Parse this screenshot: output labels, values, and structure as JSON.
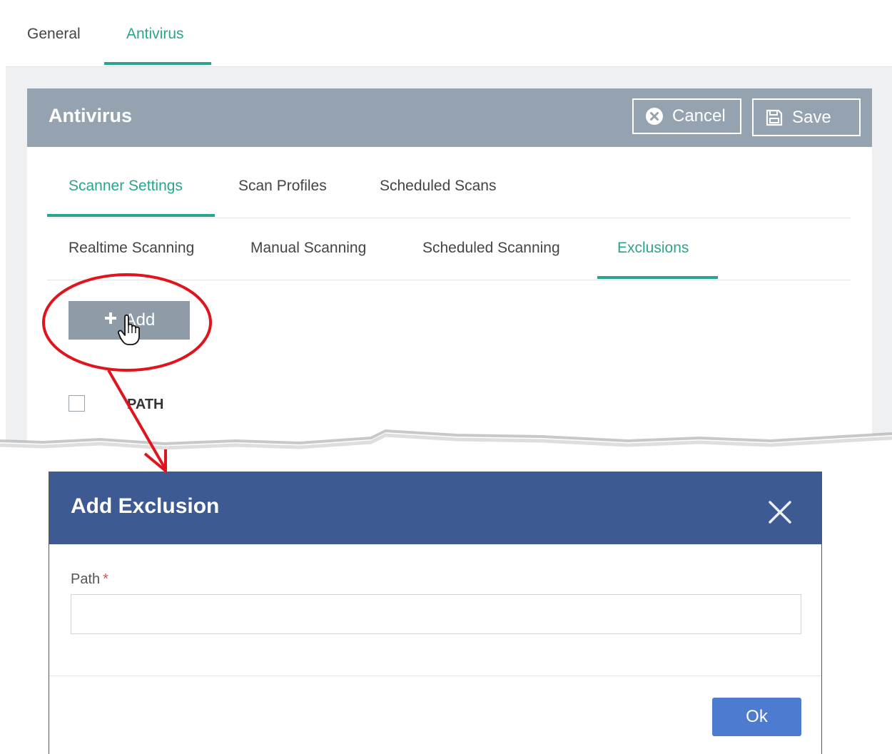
{
  "top_tabs": [
    {
      "label": "General"
    },
    {
      "label": "Antivirus"
    }
  ],
  "panel": {
    "title": "Antivirus",
    "cancel_label": "Cancel",
    "save_label": "Save"
  },
  "section_tabs": [
    {
      "label": "Scanner Settings"
    },
    {
      "label": "Scan Profiles"
    },
    {
      "label": "Scheduled Scans"
    }
  ],
  "scan_tabs": [
    {
      "label": "Realtime Scanning"
    },
    {
      "label": "Manual Scanning"
    },
    {
      "label": "Scheduled Scanning"
    },
    {
      "label": "Exclusions"
    }
  ],
  "active": {
    "top_tab": "Antivirus",
    "section_tab": "Scanner Settings",
    "scan_tab": "Exclusions"
  },
  "toolbar": {
    "add_label": "Add"
  },
  "table": {
    "columns": [
      "PATH"
    ]
  },
  "modal": {
    "title": "Add Exclusion",
    "path_label": "Path",
    "required_mark": "*",
    "path_value": "",
    "ok_label": "Ok"
  },
  "icons": {
    "cancel": "cancel-circle-icon",
    "save": "floppy-save-icon",
    "add": "plus-icon",
    "close": "close-icon",
    "cursor": "hand-pointer-icon"
  },
  "colors": {
    "accent": "#2aa58d",
    "panel_header": "#95a3b0",
    "modal_header": "#3e5a92",
    "ok_button": "#4d7bcf",
    "annotation": "#e0141c"
  }
}
